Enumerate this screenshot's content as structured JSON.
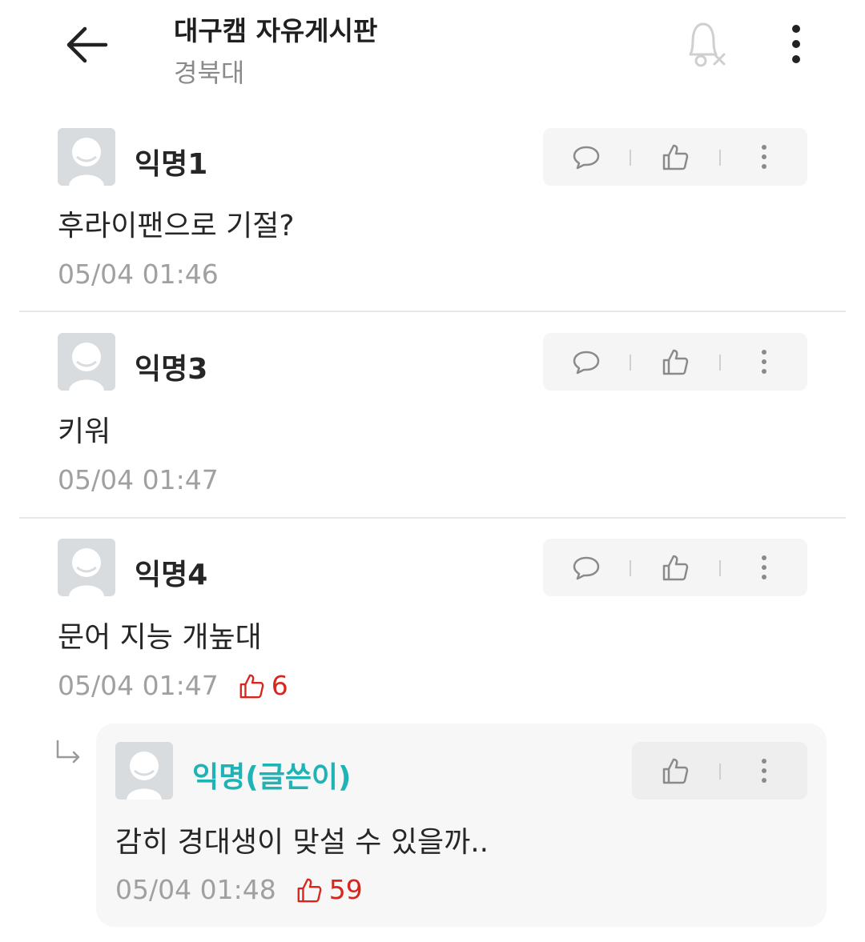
{
  "header": {
    "title": "대구캠 자유게시판",
    "subtitle": "경북대",
    "back_icon": "arrow-left-icon",
    "bell_icon": "notifications-off-icon",
    "more_icon": "more-vertical-icon"
  },
  "comments": [
    {
      "name": "익명1",
      "text": "후라이팬으로 기절?",
      "time": "05/04 01:46"
    },
    {
      "name": "익명3",
      "text": "키워",
      "time": "05/04 01:47"
    },
    {
      "name": "익명4",
      "text": "문어 지능 개높대",
      "time": "05/04 01:47",
      "likes": "6"
    }
  ],
  "reply": {
    "name": "익명(글쓴이)",
    "text": "감히 경대생이 맞설 수 있을까..",
    "time": "05/04 01:48",
    "likes": "59"
  },
  "colors": {
    "author_name": "#1fb3b6",
    "like_red": "#d7261e",
    "meta_gray": "#a0a0a0"
  }
}
